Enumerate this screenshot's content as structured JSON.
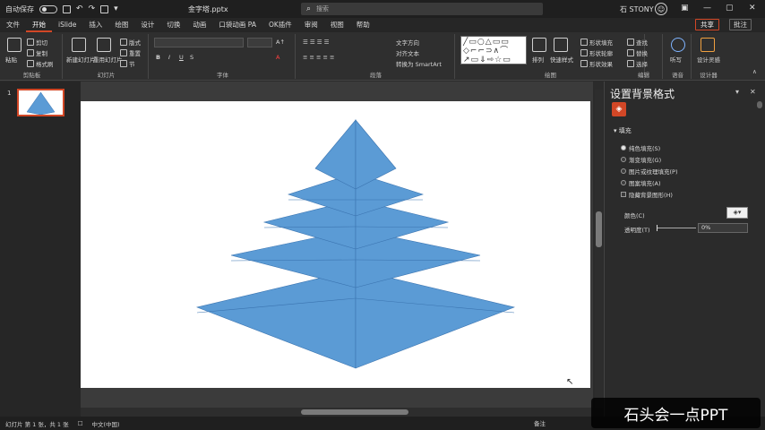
{
  "titlebar": {
    "autosave_label": "自动保存",
    "doc_title": "金字塔.pptx",
    "search_placeholder": "搜索",
    "user_name": "石 STONY",
    "minimize_glyph": "—",
    "restore_glyph": "▢",
    "close_glyph": "✕"
  },
  "ribbon_tabs": [
    "文件",
    "开始",
    "iSlide",
    "插入",
    "绘图",
    "设计",
    "切换",
    "动画",
    "口袋动画 PA",
    "OK插件",
    "审阅",
    "视图",
    "帮助"
  ],
  "ribbon_actions": {
    "share": "共享",
    "comment": "批注"
  },
  "ribbon": {
    "clipboard": {
      "label": "剪贴板",
      "paste": "粘贴",
      "cut": "剪切",
      "copy": "复制",
      "format_painter": "格式刷"
    },
    "slides": {
      "label": "幻灯片",
      "new_slide": "新建幻灯片",
      "reuse": "重用幻灯片",
      "layout": "版式",
      "reset": "重置",
      "section": "节"
    },
    "font": {
      "label": "字体",
      "bold": "B",
      "italic": "I",
      "underline": "U",
      "strike": "S",
      "font_color": "A"
    },
    "paragraph": {
      "label": "段落",
      "text_direction": "文字方向",
      "align_text": "对齐文本",
      "smartart": "转换为 SmartArt"
    },
    "drawing": {
      "label": "绘图",
      "shapes_preview": "╱▭○△▭▭ ◇⌐⌐⊃∧⌒ ↗▭⇓⇨☆▭",
      "arrange": "排列",
      "quick_styles": "快速样式",
      "shape_fill": "形状填充",
      "shape_outline": "形状轮廓",
      "shape_effects": "形状效果"
    },
    "editing": {
      "label": "编辑",
      "find": "查找",
      "replace": "替换",
      "select": "选择"
    },
    "voice": {
      "label": "语音",
      "dictate": "听写"
    },
    "designer": {
      "label": "设计器",
      "design_ideas": "设计灵感"
    }
  },
  "thumbnails": {
    "slide_number": "1"
  },
  "format_pane": {
    "title": "设置背景格式",
    "section": "填充",
    "options": [
      {
        "label": "纯色填充(S)",
        "selected": true
      },
      {
        "label": "渐变填充(G)",
        "selected": false
      },
      {
        "label": "图片或纹理填充(P)",
        "selected": false
      },
      {
        "label": "图案填充(A)",
        "selected": false
      }
    ],
    "hide_bg": "隐藏背景图形(H)",
    "color_label": "颜色(C)",
    "transparency_label": "透明度(T)",
    "transparency_value": "0%",
    "transparency": 0
  },
  "statusbar": {
    "slide_info": "幻灯片 第 1 张，共 1 张",
    "language": "中文(中国)",
    "zoom_text": "备注"
  },
  "pyramid": {
    "fill": "#5b9bd5",
    "stroke": "#3b74b0"
  },
  "watermark": "石头会一点PPT"
}
